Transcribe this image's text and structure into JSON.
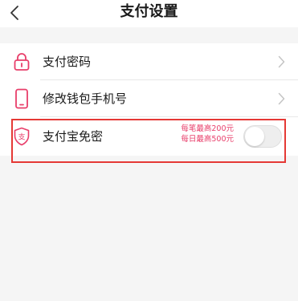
{
  "header": {
    "title": "支付设置",
    "back_icon": "chevron-left-icon"
  },
  "settings": {
    "items": [
      {
        "label": "支付密码",
        "icon": "lock-icon"
      },
      {
        "label": "修改钱包手机号",
        "icon": "phone-icon"
      },
      {
        "label": "支付宝免密",
        "icon": "alipay-shield-icon",
        "limit_per_transaction": "每笔最高200元",
        "limit_per_day": "每日最高500元",
        "toggle_on": false
      }
    ]
  },
  "colors": {
    "accent": "#e83e6a",
    "highlight_border": "#e53935",
    "background": "#f5f5f5"
  }
}
